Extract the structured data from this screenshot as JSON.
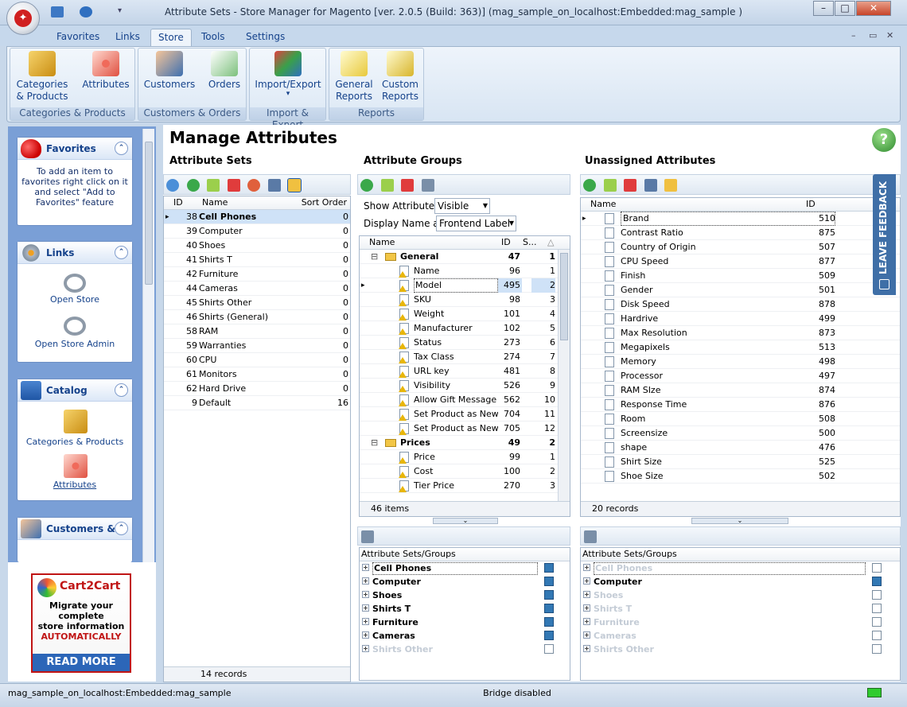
{
  "window": {
    "title": "Attribute Sets - Store Manager for Magento [ver. 2.0.5 (Build: 363)] (mag_sample_on_localhost:Embedded:mag_sample )",
    "controls": [
      "–",
      "□",
      "✕"
    ]
  },
  "ribbon_tabs": [
    "Favorites",
    "Links",
    "Store",
    "Tools",
    "Settings"
  ],
  "active_tab": "Store",
  "ribbon": {
    "groups": [
      {
        "label": "Categories & Products",
        "buttons": [
          "Categories & Products",
          "Attributes"
        ]
      },
      {
        "label": "Customers & Orders",
        "buttons": [
          "Customers",
          "Orders"
        ]
      },
      {
        "label": "Import & Export",
        "buttons": [
          "Import/Export"
        ]
      },
      {
        "label": "Reports",
        "buttons": [
          "General Reports",
          "Custom Reports"
        ]
      }
    ],
    "btn_cat_1": "Categories",
    "btn_cat_2": "& Products",
    "btn_attr": "Attributes",
    "btn_cust": "Customers",
    "btn_orders": "Orders",
    "btn_ie": "Import/Export",
    "btn_ie_arrow": "▾",
    "btn_gr_1": "General",
    "btn_gr_2": "Reports",
    "btn_cr_1": "Custom",
    "btn_cr_2": "Reports"
  },
  "sidebar": {
    "favorites": {
      "title": "Favorites",
      "hint": "To add an item to favorites right click on it and select \"Add to Favorites\" feature"
    },
    "links": {
      "title": "Links",
      "items": [
        "Open Store",
        "Open Store Admin"
      ]
    },
    "catalog": {
      "title": "Catalog",
      "items": [
        "Categories & Products",
        "Attributes"
      ]
    },
    "customers": {
      "title": "Customers &..."
    },
    "chevron": "⌃"
  },
  "ad": {
    "brand": "Cart2Cart",
    "line1": "Migrate your",
    "line2": "complete",
    "line3": "store information",
    "line4": "AUTOMATICALLY",
    "cta": "READ MORE"
  },
  "main": {
    "title": "Manage Attributes",
    "attribute_sets": {
      "heading": "Attribute Sets",
      "columns": [
        "ID",
        "Name",
        "Sort Order"
      ],
      "rows": [
        {
          "id": "38",
          "name": "Cell Phones",
          "sort": "0"
        },
        {
          "id": "39",
          "name": "Computer",
          "sort": "0"
        },
        {
          "id": "40",
          "name": "Shoes",
          "sort": "0"
        },
        {
          "id": "41",
          "name": "Shirts T",
          "sort": "0"
        },
        {
          "id": "42",
          "name": "Furniture",
          "sort": "0"
        },
        {
          "id": "44",
          "name": "Cameras",
          "sort": "0"
        },
        {
          "id": "45",
          "name": "Shirts Other",
          "sort": "0"
        },
        {
          "id": "46",
          "name": "Shirts (General)",
          "sort": "0"
        },
        {
          "id": "58",
          "name": "RAM",
          "sort": "0"
        },
        {
          "id": "59",
          "name": "Warranties",
          "sort": "0"
        },
        {
          "id": "60",
          "name": "CPU",
          "sort": "0"
        },
        {
          "id": "61",
          "name": "Monitors",
          "sort": "0"
        },
        {
          "id": "62",
          "name": "Hard Drive",
          "sort": "0"
        },
        {
          "id": "9",
          "name": "Default",
          "sort": "16"
        }
      ],
      "status": "14 records"
    },
    "attribute_groups": {
      "heading": "Attribute Groups",
      "show_label": "Show Attributes",
      "show_value": "Visible",
      "display_label": "Display Name as",
      "display_value": "Frontend Label",
      "columns": [
        "Name",
        "ID",
        "S..."
      ],
      "groups": [
        {
          "name": "General",
          "id": "47",
          "s": "1",
          "items": [
            {
              "name": "Name",
              "id": "96",
              "s": "1"
            },
            {
              "name": "Model",
              "id": "495",
              "s": "2"
            },
            {
              "name": "SKU",
              "id": "98",
              "s": "3"
            },
            {
              "name": "Weight",
              "id": "101",
              "s": "4"
            },
            {
              "name": "Manufacturer",
              "id": "102",
              "s": "5"
            },
            {
              "name": "Status",
              "id": "273",
              "s": "6"
            },
            {
              "name": "Tax Class",
              "id": "274",
              "s": "7"
            },
            {
              "name": "URL key",
              "id": "481",
              "s": "8"
            },
            {
              "name": "Visibility",
              "id": "526",
              "s": "9"
            },
            {
              "name": "Allow Gift Message",
              "id": "562",
              "s": "10"
            },
            {
              "name": "Set Product as New fr",
              "id": "704",
              "s": "11"
            },
            {
              "name": "Set Product as New tc",
              "id": "705",
              "s": "12"
            }
          ]
        },
        {
          "name": "Prices",
          "id": "49",
          "s": "2",
          "items": [
            {
              "name": "Price",
              "id": "99",
              "s": "1"
            },
            {
              "name": "Cost",
              "id": "100",
              "s": "2"
            },
            {
              "name": "Tier Price",
              "id": "270",
              "s": "3"
            }
          ]
        }
      ],
      "status": "46 items"
    },
    "unassigned": {
      "heading": "Unassigned Attributes",
      "columns": [
        "Name",
        "ID"
      ],
      "rows": [
        {
          "name": "Brand",
          "id": "510"
        },
        {
          "name": "Contrast Ratio",
          "id": "875"
        },
        {
          "name": "Country of Origin",
          "id": "507"
        },
        {
          "name": "CPU Speed",
          "id": "877"
        },
        {
          "name": "Finish",
          "id": "509"
        },
        {
          "name": "Gender",
          "id": "501"
        },
        {
          "name": "Disk Speed",
          "id": "878"
        },
        {
          "name": "Hardrive",
          "id": "499"
        },
        {
          "name": "Max Resolution",
          "id": "873"
        },
        {
          "name": "Megapixels",
          "id": "513"
        },
        {
          "name": "Memory",
          "id": "498"
        },
        {
          "name": "Processor",
          "id": "497"
        },
        {
          "name": "RAM SIze",
          "id": "874"
        },
        {
          "name": "Response Time",
          "id": "876"
        },
        {
          "name": "Room",
          "id": "508"
        },
        {
          "name": "Screensize",
          "id": "500"
        },
        {
          "name": "shape",
          "id": "476"
        },
        {
          "name": "Shirt Size",
          "id": "525"
        },
        {
          "name": "Shoe Size",
          "id": "502"
        }
      ],
      "status": "20 records"
    },
    "sets_groups_left": {
      "header": "Attribute Sets/Groups",
      "rows": [
        {
          "name": "Cell Phones",
          "checked": true,
          "dim": false
        },
        {
          "name": "Computer",
          "checked": true,
          "dim": false
        },
        {
          "name": "Shoes",
          "checked": true,
          "dim": false
        },
        {
          "name": "Shirts T",
          "checked": true,
          "dim": false
        },
        {
          "name": "Furniture",
          "checked": true,
          "dim": false
        },
        {
          "name": "Cameras",
          "checked": true,
          "dim": false
        },
        {
          "name": "Shirts Other",
          "checked": false,
          "dim": true
        }
      ]
    },
    "sets_groups_right": {
      "header": "Attribute Sets/Groups",
      "rows": [
        {
          "name": "Cell Phones",
          "checked": false,
          "dim": true
        },
        {
          "name": "Computer",
          "checked": true,
          "dim": false
        },
        {
          "name": "Shoes",
          "checked": false,
          "dim": true
        },
        {
          "name": "Shirts T",
          "checked": false,
          "dim": true
        },
        {
          "name": "Furniture",
          "checked": false,
          "dim": true
        },
        {
          "name": "Cameras",
          "checked": false,
          "dim": true
        },
        {
          "name": "Shirts Other",
          "checked": false,
          "dim": true
        }
      ]
    },
    "feedback": "LEAVE FEEDBACK"
  },
  "statusbar": {
    "connection": "mag_sample_on_localhost:Embedded:mag_sample",
    "bridge": "Bridge disabled"
  },
  "colors": {
    "accent": "#15428b",
    "selection": "#cfe2f7",
    "warning": "#e8b60a",
    "ad_red": "#c01414"
  }
}
